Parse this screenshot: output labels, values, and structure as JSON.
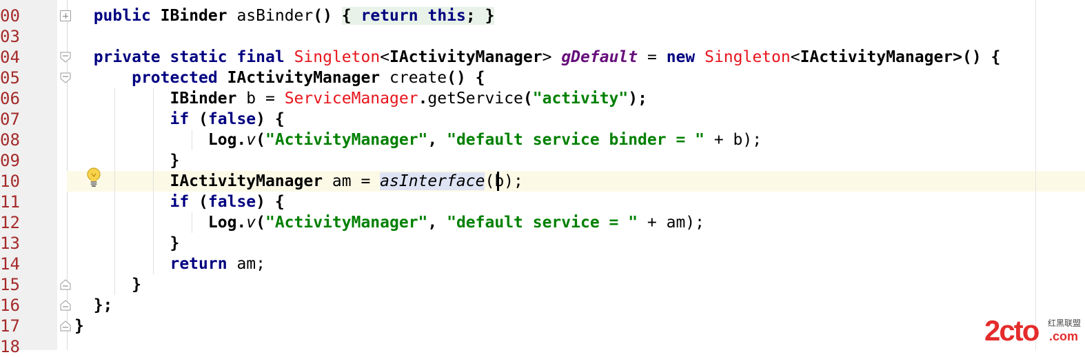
{
  "editor": {
    "current_line_index": 9,
    "colors": {
      "keyword": "#000080",
      "string": "#008000",
      "type_red": "#e8141c",
      "static_field": "#660e7a",
      "line_number": "#a52a2a",
      "current_line_bg": "#fcfae6"
    },
    "lines": [
      {
        "num": "00",
        "code": "",
        "fold": "plus"
      },
      {
        "num": "03",
        "code": "",
        "fold": ""
      },
      {
        "num": "04",
        "code": "",
        "fold": "open"
      },
      {
        "num": "05",
        "code": "",
        "fold": "open"
      },
      {
        "num": "06",
        "code": "",
        "fold": ""
      },
      {
        "num": "07",
        "code": "",
        "fold": ""
      },
      {
        "num": "08",
        "code": "",
        "fold": ""
      },
      {
        "num": "09",
        "code": "",
        "fold": ""
      },
      {
        "num": "10",
        "code": "",
        "fold": ""
      },
      {
        "num": "11",
        "code": "",
        "fold": ""
      },
      {
        "num": "12",
        "code": "",
        "fold": ""
      },
      {
        "num": "13",
        "code": "",
        "fold": ""
      },
      {
        "num": "14",
        "code": "",
        "fold": ""
      },
      {
        "num": "15",
        "code": "",
        "fold": "close"
      },
      {
        "num": "16",
        "code": "",
        "fold": "close"
      },
      {
        "num": "17",
        "code": "",
        "fold": "close"
      },
      {
        "num": "18",
        "code": "",
        "fold": ""
      }
    ],
    "tokens": {
      "l00_public": "public",
      "l00_ibinder": "IBinder",
      "l00_asbinder": "asBinder",
      "l00_parens": "()",
      "l00_open": "{",
      "l00_return": "return",
      "l00_this": "this",
      "l00_semi": ";",
      "l00_close": "}",
      "l04_private": "private",
      "l04_static": "static",
      "l04_final": "final",
      "l04_singleton1": "Singleton",
      "l04_lt1": "<",
      "l04_iam1": "IActivityManager",
      "l04_gt1": ">",
      "l04_gdefault": "gDefault",
      "l04_eq": "=",
      "l04_new": "new",
      "l04_singleton2": "Singleton",
      "l04_lt2": "<",
      "l04_iam2": "IActivityManager",
      "l04_tail": ">() {",
      "l05_protected": "protected",
      "l05_iam": "IActivityManager",
      "l05_create": "create",
      "l05_tail": "() {",
      "l06_ibinder": "IBinder",
      "l06_b": "b =",
      "l06_sm": "ServiceManager",
      "l06_dot": ".",
      "l06_getservice": "getService",
      "l06_paren": "(",
      "l06_str": "\"activity\"",
      "l06_tail": ");",
      "l07_if": "if",
      "l07_open": "(",
      "l07_false": "false",
      "l07_tail": ") {",
      "l08_log": "Log.",
      "l08_v": "v",
      "l08_paren": "(",
      "l08_str1": "\"ActivityManager\"",
      "l08_comma": ",",
      "l08_str2": "\"default service binder = \"",
      "l08_tail": "+ b);",
      "l09_close": "}",
      "l10_iam": "IActivityManager",
      "l10_am": "am =",
      "l10_asinterface": "asInterface",
      "l10_tail": "(b);",
      "l11_if": "if",
      "l11_open": "(",
      "l11_false": "false",
      "l11_tail": ") {",
      "l12_log": "Log.",
      "l12_v": "v",
      "l12_paren": "(",
      "l12_str1": "\"ActivityManager\"",
      "l12_comma": ",",
      "l12_str2": "\"default service = \"",
      "l12_tail": "+ am);",
      "l13_close": "}",
      "l14_return": "return",
      "l14_am": "am;",
      "l15_close": "}",
      "l16_close": "};",
      "l17_close": "}"
    }
  },
  "intention_icon": "lightbulb-icon",
  "watermark": {
    "main": "2cto",
    "sub": "红黑联盟",
    "domain": ".com"
  }
}
